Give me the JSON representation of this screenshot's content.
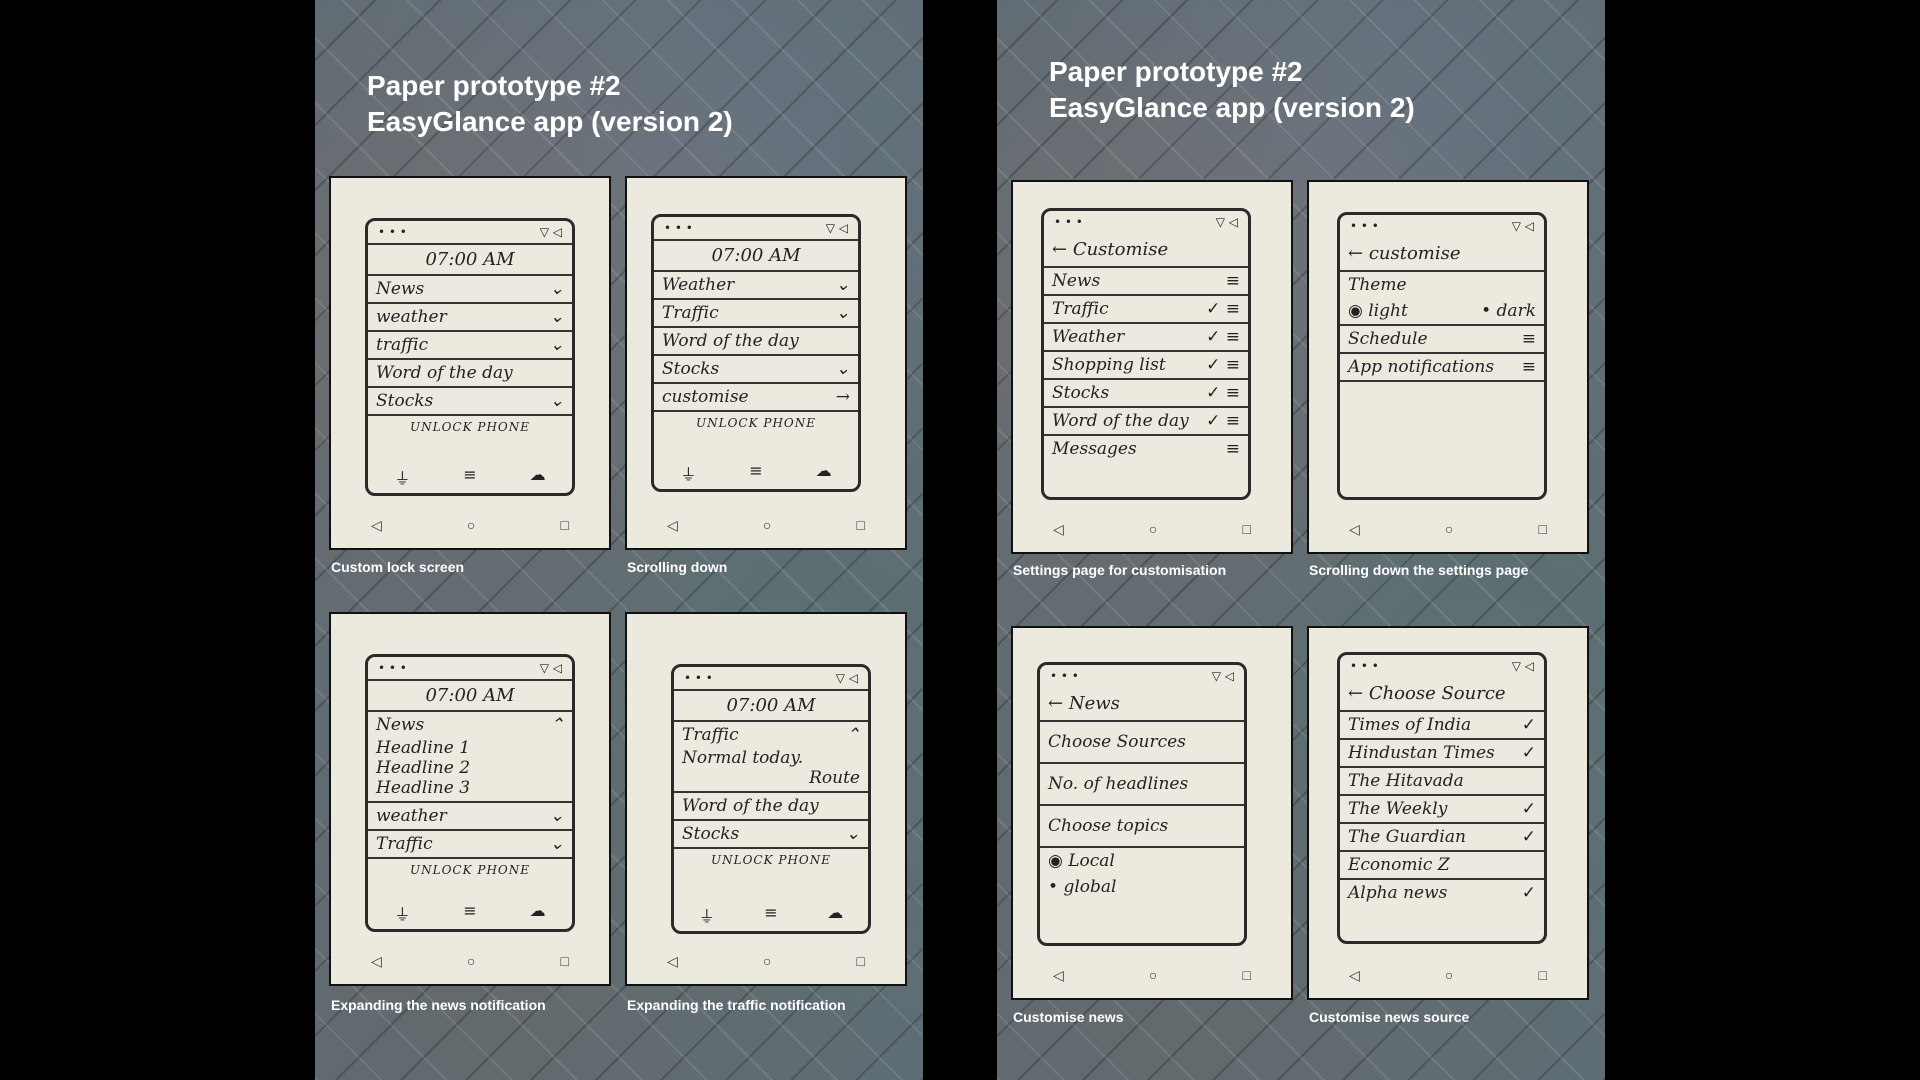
{
  "slides": [
    {
      "title_line1": "Paper prototype #2",
      "title_line2": "EasyGlance app (version 2)",
      "cards": [
        {
          "caption": "Custom lock screen",
          "time": "07:00 AM",
          "rows": [
            "News",
            "weather",
            "traffic",
            "Word of the day",
            "Stocks"
          ],
          "unlock": "UNLOCK PHONE"
        },
        {
          "caption": "Scrolling down",
          "time": "07:00 AM",
          "rows": [
            "Weather",
            "Traffic",
            "Word of the day",
            "Stocks",
            "customise"
          ],
          "unlock": "UNLOCK PHONE"
        },
        {
          "caption": "Expanding the news notification",
          "time": "07:00 AM",
          "rows": [
            "News",
            "Headline 1",
            "Headline 2",
            "Headline 3",
            "weather",
            "Traffic"
          ],
          "unlock": "UNLOCK PHONE"
        },
        {
          "caption": "Expanding the traffic notification",
          "time": "07:00 AM",
          "rows": [
            "Traffic",
            "Normal today.",
            "Route",
            "Word of the day",
            "Stocks"
          ],
          "unlock": "UNLOCK PHONE"
        }
      ]
    },
    {
      "title_line1": "Paper prototype #2",
      "title_line2": "EasyGlance app (version 2)",
      "cards": [
        {
          "caption": "Settings page for customisation",
          "header": "Customise",
          "rows": [
            "News",
            "Traffic",
            "Weather",
            "Shopping list",
            "Stocks",
            "Word of the day",
            "Messages"
          ]
        },
        {
          "caption": "Scrolling down the settings page",
          "header": "customise",
          "rows": [
            "Theme",
            "light",
            "dark",
            "Schedule",
            "App notifications"
          ]
        },
        {
          "caption": "Customise news",
          "header": "News",
          "rows": [
            "Choose Sources",
            "No. of headlines",
            "Choose topics",
            "Local",
            "global"
          ]
        },
        {
          "caption": "Customise news source",
          "header": "Choose Source",
          "rows": [
            "Times of India",
            "Hindustan Times",
            "The Hitavada",
            "The Weekly",
            "The Guardian",
            "Economic Z",
            "Alpha news"
          ]
        }
      ]
    }
  ]
}
